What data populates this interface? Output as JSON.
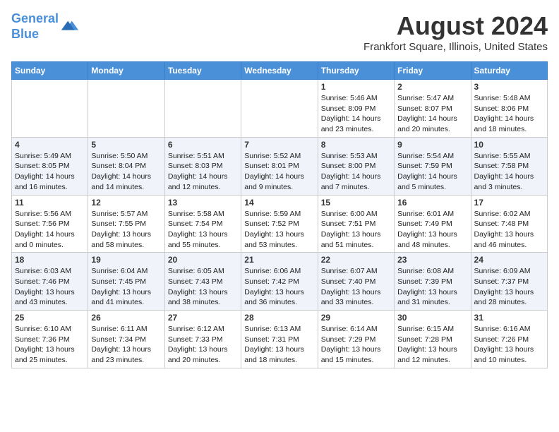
{
  "header": {
    "logo_line1": "General",
    "logo_line2": "Blue",
    "month": "August 2024",
    "location": "Frankfort Square, Illinois, United States"
  },
  "days_of_week": [
    "Sunday",
    "Monday",
    "Tuesday",
    "Wednesday",
    "Thursday",
    "Friday",
    "Saturday"
  ],
  "weeks": [
    [
      {
        "day": "",
        "info": ""
      },
      {
        "day": "",
        "info": ""
      },
      {
        "day": "",
        "info": ""
      },
      {
        "day": "",
        "info": ""
      },
      {
        "day": "1",
        "info": "Sunrise: 5:46 AM\nSunset: 8:09 PM\nDaylight: 14 hours\nand 23 minutes."
      },
      {
        "day": "2",
        "info": "Sunrise: 5:47 AM\nSunset: 8:07 PM\nDaylight: 14 hours\nand 20 minutes."
      },
      {
        "day": "3",
        "info": "Sunrise: 5:48 AM\nSunset: 8:06 PM\nDaylight: 14 hours\nand 18 minutes."
      }
    ],
    [
      {
        "day": "4",
        "info": "Sunrise: 5:49 AM\nSunset: 8:05 PM\nDaylight: 14 hours\nand 16 minutes."
      },
      {
        "day": "5",
        "info": "Sunrise: 5:50 AM\nSunset: 8:04 PM\nDaylight: 14 hours\nand 14 minutes."
      },
      {
        "day": "6",
        "info": "Sunrise: 5:51 AM\nSunset: 8:03 PM\nDaylight: 14 hours\nand 12 minutes."
      },
      {
        "day": "7",
        "info": "Sunrise: 5:52 AM\nSunset: 8:01 PM\nDaylight: 14 hours\nand 9 minutes."
      },
      {
        "day": "8",
        "info": "Sunrise: 5:53 AM\nSunset: 8:00 PM\nDaylight: 14 hours\nand 7 minutes."
      },
      {
        "day": "9",
        "info": "Sunrise: 5:54 AM\nSunset: 7:59 PM\nDaylight: 14 hours\nand 5 minutes."
      },
      {
        "day": "10",
        "info": "Sunrise: 5:55 AM\nSunset: 7:58 PM\nDaylight: 14 hours\nand 3 minutes."
      }
    ],
    [
      {
        "day": "11",
        "info": "Sunrise: 5:56 AM\nSunset: 7:56 PM\nDaylight: 14 hours\nand 0 minutes."
      },
      {
        "day": "12",
        "info": "Sunrise: 5:57 AM\nSunset: 7:55 PM\nDaylight: 13 hours\nand 58 minutes."
      },
      {
        "day": "13",
        "info": "Sunrise: 5:58 AM\nSunset: 7:54 PM\nDaylight: 13 hours\nand 55 minutes."
      },
      {
        "day": "14",
        "info": "Sunrise: 5:59 AM\nSunset: 7:52 PM\nDaylight: 13 hours\nand 53 minutes."
      },
      {
        "day": "15",
        "info": "Sunrise: 6:00 AM\nSunset: 7:51 PM\nDaylight: 13 hours\nand 51 minutes."
      },
      {
        "day": "16",
        "info": "Sunrise: 6:01 AM\nSunset: 7:49 PM\nDaylight: 13 hours\nand 48 minutes."
      },
      {
        "day": "17",
        "info": "Sunrise: 6:02 AM\nSunset: 7:48 PM\nDaylight: 13 hours\nand 46 minutes."
      }
    ],
    [
      {
        "day": "18",
        "info": "Sunrise: 6:03 AM\nSunset: 7:46 PM\nDaylight: 13 hours\nand 43 minutes."
      },
      {
        "day": "19",
        "info": "Sunrise: 6:04 AM\nSunset: 7:45 PM\nDaylight: 13 hours\nand 41 minutes."
      },
      {
        "day": "20",
        "info": "Sunrise: 6:05 AM\nSunset: 7:43 PM\nDaylight: 13 hours\nand 38 minutes."
      },
      {
        "day": "21",
        "info": "Sunrise: 6:06 AM\nSunset: 7:42 PM\nDaylight: 13 hours\nand 36 minutes."
      },
      {
        "day": "22",
        "info": "Sunrise: 6:07 AM\nSunset: 7:40 PM\nDaylight: 13 hours\nand 33 minutes."
      },
      {
        "day": "23",
        "info": "Sunrise: 6:08 AM\nSunset: 7:39 PM\nDaylight: 13 hours\nand 31 minutes."
      },
      {
        "day": "24",
        "info": "Sunrise: 6:09 AM\nSunset: 7:37 PM\nDaylight: 13 hours\nand 28 minutes."
      }
    ],
    [
      {
        "day": "25",
        "info": "Sunrise: 6:10 AM\nSunset: 7:36 PM\nDaylight: 13 hours\nand 25 minutes."
      },
      {
        "day": "26",
        "info": "Sunrise: 6:11 AM\nSunset: 7:34 PM\nDaylight: 13 hours\nand 23 minutes."
      },
      {
        "day": "27",
        "info": "Sunrise: 6:12 AM\nSunset: 7:33 PM\nDaylight: 13 hours\nand 20 minutes."
      },
      {
        "day": "28",
        "info": "Sunrise: 6:13 AM\nSunset: 7:31 PM\nDaylight: 13 hours\nand 18 minutes."
      },
      {
        "day": "29",
        "info": "Sunrise: 6:14 AM\nSunset: 7:29 PM\nDaylight: 13 hours\nand 15 minutes."
      },
      {
        "day": "30",
        "info": "Sunrise: 6:15 AM\nSunset: 7:28 PM\nDaylight: 13 hours\nand 12 minutes."
      },
      {
        "day": "31",
        "info": "Sunrise: 6:16 AM\nSunset: 7:26 PM\nDaylight: 13 hours\nand 10 minutes."
      }
    ]
  ]
}
